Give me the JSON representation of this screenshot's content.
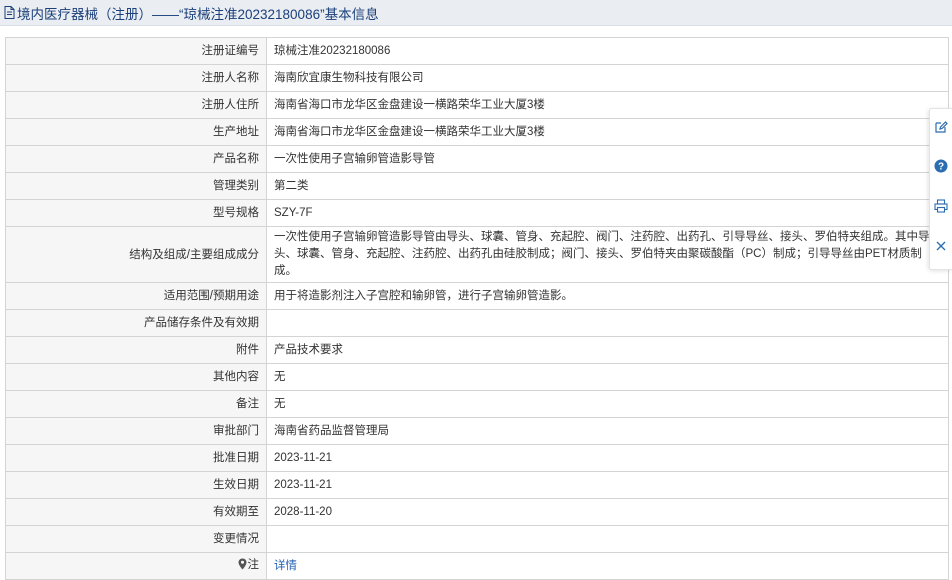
{
  "header": {
    "title": "境内医疗器械（注册）——“琼械注准20232180086”基本信息"
  },
  "record": {
    "rows": [
      {
        "label": "注册证编号",
        "value": "琼械注准20232180086"
      },
      {
        "label": "注册人名称",
        "value": "海南欣宜康生物科技有限公司"
      },
      {
        "label": "注册人住所",
        "value": "海南省海口市龙华区金盘建设一横路荣华工业大厦3楼"
      },
      {
        "label": "生产地址",
        "value": "海南省海口市龙华区金盘建设一横路荣华工业大厦3楼"
      },
      {
        "label": "产品名称",
        "value": "一次性使用子宫输卵管造影导管"
      },
      {
        "label": "管理类别",
        "value": "第二类"
      },
      {
        "label": "型号规格",
        "value": "SZY-7F"
      },
      {
        "label": "结构及组成/主要组成成分",
        "value": "一次性使用子宫输卵管造影导管由导头、球囊、管身、充起腔、阀门、注药腔、出药孔、引导导丝、接头、罗伯特夹组成。其中导头、球囊、管身、充起腔、注药腔、出药孔由硅胶制成；阀门、接头、罗伯特夹由聚碳酸酯（PC）制成；引导导丝由PET材质制成。"
      },
      {
        "label": "适用范围/预期用途",
        "value": "用于将造影剂注入子宫腔和输卵管，进行子宫输卵管造影。"
      },
      {
        "label": "产品储存条件及有效期",
        "value": ""
      },
      {
        "label": "附件",
        "value": "产品技术要求"
      },
      {
        "label": "其他内容",
        "value": "无"
      },
      {
        "label": "备注",
        "value": "无"
      },
      {
        "label": "审批部门",
        "value": "海南省药品监督管理局"
      },
      {
        "label": "批准日期",
        "value": "2023-11-21"
      },
      {
        "label": "生效日期",
        "value": "2023-11-21"
      },
      {
        "label": "有效期至",
        "value": "2028-11-20"
      },
      {
        "label": "变更情况",
        "value": ""
      }
    ],
    "note_label": "注",
    "note_link": "详情"
  },
  "icons": {
    "header": "document-icon",
    "note": "map-pin-icon",
    "toolbar": [
      "edit-icon",
      "help-icon",
      "print-icon",
      "close-icon"
    ]
  },
  "colors": {
    "title": "#1a3f7a",
    "link": "#1e5fb4",
    "label_bg": "#f6f6f6",
    "border": "#d4d4d4",
    "toolbar_icon": "#2c6cb0"
  }
}
